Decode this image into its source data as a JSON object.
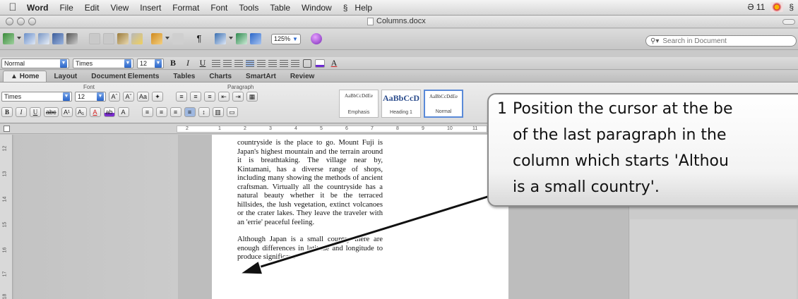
{
  "menu_bar": {
    "items": [
      "Word",
      "File",
      "Edit",
      "View",
      "Insert",
      "Format",
      "Font",
      "Tools",
      "Table",
      "Window",
      "Help"
    ],
    "status_text": "11"
  },
  "window": {
    "title": "Columns.docx"
  },
  "toolbar": {
    "zoom": "125%"
  },
  "search": {
    "placeholder": "Search in Document"
  },
  "formatting": {
    "style": "Normal",
    "font": "Times",
    "size": "12"
  },
  "ribbon": {
    "tabs": [
      "Home",
      "Layout",
      "Document Elements",
      "Tables",
      "Charts",
      "SmartArt",
      "Review"
    ],
    "group_font_label": "Font",
    "group_paragraph_label": "Paragraph",
    "font": "Times",
    "size": "12",
    "styles": [
      {
        "sample": "AaBbCcDdEe",
        "name": "Emphasis"
      },
      {
        "sample": "AaBbCcD",
        "name": "Heading 1"
      },
      {
        "sample": "AaBbCcDdEe",
        "name": "Normal"
      }
    ]
  },
  "ruler_ticks": [
    "2",
    "1",
    "2",
    "3",
    "4",
    "5",
    "6",
    "7",
    "8",
    "9",
    "10",
    "11"
  ],
  "vruler_ticks": [
    "12",
    "13",
    "14",
    "15",
    "16",
    "17",
    "18"
  ],
  "document": {
    "paragraph1": "countryside is the place to go. Mount Fuji is Japan's highest mountain and the terrain around it is breathtaking. The village near by, Kintamani, has a diverse range of shops, including many showing the methods of ancient craftsman. Virtually all the countryside has a natural beauty whether it be the terraced hillsides, the lush vegetation, extinct volcanoes or the crater lakes. They leave the traveler with an 'errie' peaceful feeling.",
    "paragraph2": "Although Japan is a small country there are enough differences in latitude and longitude to produce significant"
  },
  "callout": {
    "number": "1",
    "line1": "Position the cursor at the be",
    "line2": "of the last paragraph in the",
    "line3": "column which starts 'Althou",
    "line4": "is a small country'."
  }
}
